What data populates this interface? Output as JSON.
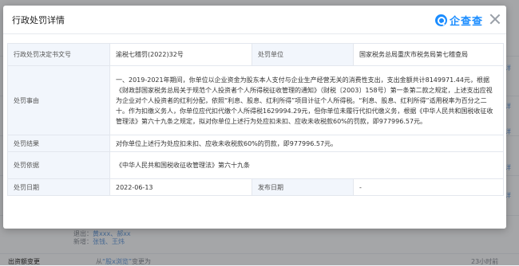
{
  "modal": {
    "title": "行政处罚详情",
    "brand": "企查查",
    "brand_logo": "qichacha-logo-icon",
    "close_icon": "close-icon"
  },
  "details": {
    "doc_label": "行政处罚决定书文号",
    "doc_value": "渝税七稽罚(2022)32号",
    "org_label": "处罚单位",
    "org_value": "国家税务总局重庆市税务局第七稽查局",
    "reason_label": "处罚事由",
    "reason_value": "一、2019-2021年期间，你单位以企业资金为股东本人支付与企业生产经营无关的消费性支出，支出金额共计8149971.44元，根据《财政部国家税务总局关于规范个人投资者个人所得税征收管理的通知》（财税〔2003〕158号）第一条第二款之规定，上述支出应视为企业对个人投资者的红利分配，依照“利息、股息、红利所得”项目计征个人所得税。“利息、股息、红利所得”适用税率为百分之二十。作为扣缴义务人，你单位应代扣代缴个人所得税1629994.29元，但你单位未履行代扣代缴义务，根据《中华人民共和国税收征收管理法》第六十九条之规定，拟对你单位上述行为处应扣未扣、应收未收税款60%的罚款，即977996.57元。",
    "result_label": "处罚结果",
    "result_value": "对你单位上述行为处应扣未扣、应收未收税款60%的罚款，即977996.57元。",
    "basis_label": "处罚依据",
    "basis_value": "《中华人民共和国税收征收管理法》第六十九条",
    "date_label": "处罚日期",
    "date_value": "2022-06-13",
    "pub_label": "发布日期",
    "pub_value": "-"
  },
  "background": {
    "right_links": [
      "详",
      "详",
      "详",
      "详",
      "详"
    ],
    "snippet1_prefix": "退出：",
    "snippet1_link": "黄xxx、郝xx",
    "snippet2_prefix": "新增：",
    "snippet2_link": "张钱、王炜",
    "footer_left": "出资额变更",
    "footer_mid_prefix": "从",
    "footer_mid_link": "“股x浏览”",
    "footer_mid_suffix": "变更为",
    "footer_right": "23小时前"
  }
}
